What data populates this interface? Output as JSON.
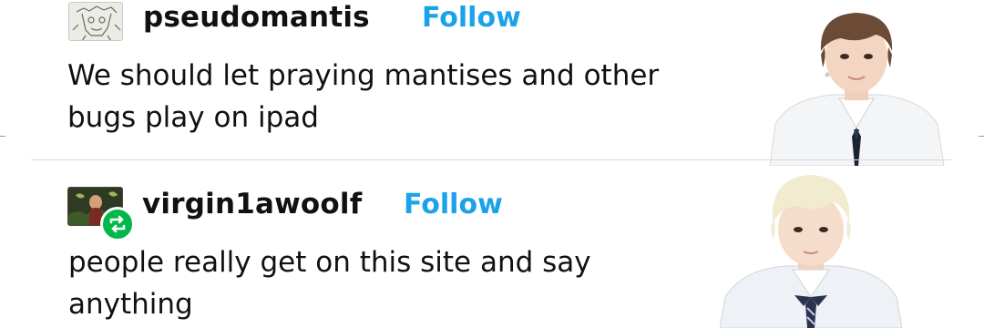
{
  "posts": [
    {
      "username": "pseudomantis",
      "follow_label": "Follow",
      "avatar_icon": "sketch-avatar-icon",
      "body": "We should let praying mantises and other\nbugs play on ipad"
    },
    {
      "username": "virgin1awoolf",
      "follow_label": "Follow",
      "avatar_icon": "painting-avatar-icon",
      "badge_icon": "reblog-icon",
      "body": "people really get on this site and say\nanything"
    }
  ],
  "colors": {
    "follow": "#1aa3e8",
    "reblog_badge": "#00b84a",
    "text": "#111111",
    "divider": "#d9d9d9"
  }
}
